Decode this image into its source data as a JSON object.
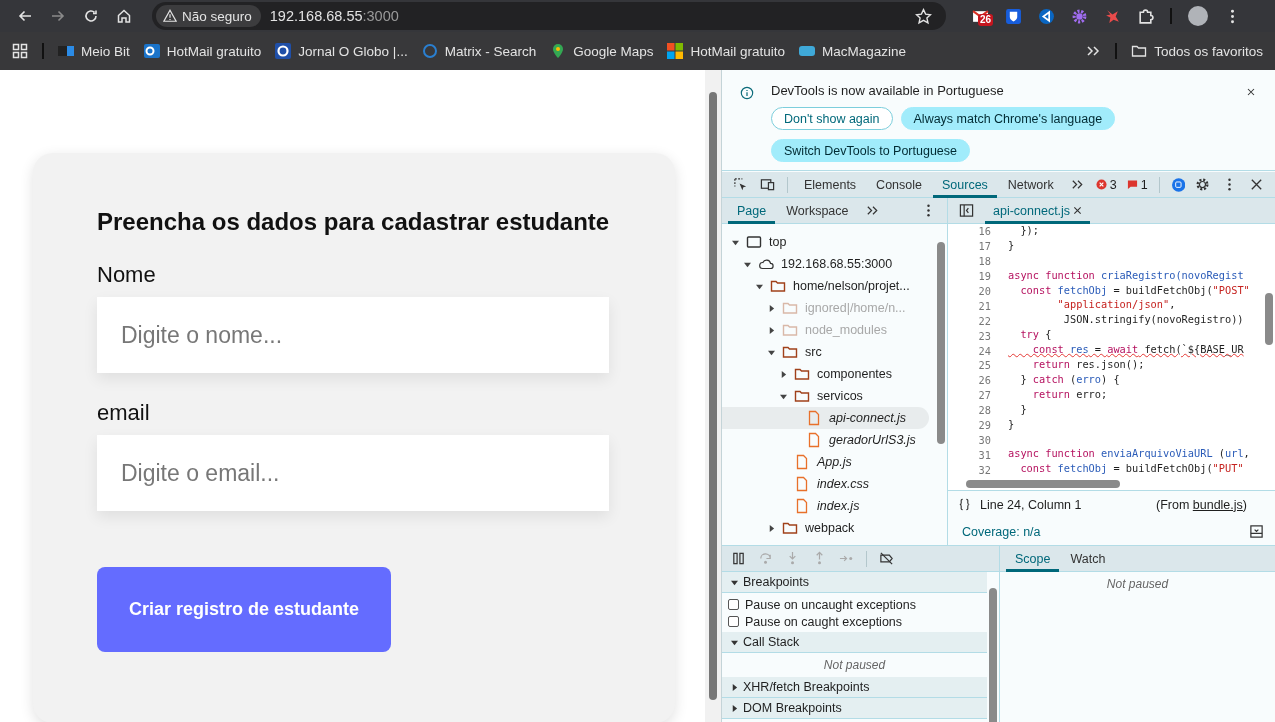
{
  "address_bar": {
    "security_label": "Não seguro",
    "host": "192.168.68.55",
    "port": ":3000"
  },
  "extension_badge": "26",
  "bookmarks": [
    {
      "label": "Meio Bit"
    },
    {
      "label": "HotMail gratuito"
    },
    {
      "label": "Jornal O Globo |..."
    },
    {
      "label": "Matrix - Search"
    },
    {
      "label": "Google Maps"
    },
    {
      "label": "HotMail gratuito"
    },
    {
      "label": "MacMagazine"
    }
  ],
  "all_bookmarks": "Todos os favoritos",
  "page": {
    "title": "Preencha os dados para cadastrar estudante",
    "fields": [
      {
        "label": "Nome",
        "placeholder": "Digite o nome..."
      },
      {
        "label": "email",
        "placeholder": "Digite o email..."
      }
    ],
    "submit": "Criar registro de estudante"
  },
  "devtools": {
    "infobar": {
      "message": "DevTools is now available in Portuguese",
      "buttons": [
        {
          "label": "Don't show again",
          "kind": "outline"
        },
        {
          "label": "Always match Chrome's language",
          "kind": "filled"
        },
        {
          "label": "Switch DevTools to Portuguese",
          "kind": "filled"
        }
      ]
    },
    "tabs": [
      {
        "label": "Elements",
        "selected": false
      },
      {
        "label": "Console",
        "selected": false
      },
      {
        "label": "Sources",
        "selected": true
      },
      {
        "label": "Network",
        "selected": false
      }
    ],
    "error_count": "3",
    "issue_count": "1",
    "navigator_tabs": [
      {
        "label": "Page",
        "selected": true
      },
      {
        "label": "Workspace",
        "selected": false
      }
    ],
    "tree": [
      {
        "label": "top",
        "kind": "frame",
        "expanded": true,
        "selected": false,
        "dimmed": false,
        "children": [
          {
            "label": "192.168.68.55:3000",
            "kind": "domain",
            "expanded": true,
            "selected": false,
            "dimmed": false,
            "children": [
              {
                "label": "home/nelson/projet...",
                "kind": "folder",
                "expanded": true,
                "selected": false,
                "dimmed": false,
                "children": [
                  {
                    "label": "ignored|/home/n...",
                    "kind": "folder",
                    "expanded": false,
                    "selected": false,
                    "dimmed": true
                  },
                  {
                    "label": "node_modules",
                    "kind": "folder",
                    "expanded": false,
                    "selected": false,
                    "dimmed": true
                  },
                  {
                    "label": "src",
                    "kind": "folder",
                    "expanded": true,
                    "selected": false,
                    "dimmed": false,
                    "children": [
                      {
                        "label": "componentes",
                        "kind": "folder",
                        "expanded": false,
                        "selected": false,
                        "dimmed": false
                      },
                      {
                        "label": "servicos",
                        "kind": "folder",
                        "expanded": true,
                        "selected": false,
                        "dimmed": false,
                        "children": [
                          {
                            "label": "api-connect.js",
                            "kind": "file",
                            "selected": true,
                            "dimmed": false
                          },
                          {
                            "label": "geradorUrlS3.js",
                            "kind": "file",
                            "selected": false,
                            "dimmed": false
                          }
                        ]
                      },
                      {
                        "label": "App.js",
                        "kind": "file",
                        "selected": false,
                        "dimmed": false
                      },
                      {
                        "label": "index.css",
                        "kind": "file",
                        "selected": false,
                        "dimmed": false
                      },
                      {
                        "label": "index.js",
                        "kind": "file",
                        "selected": false,
                        "dimmed": false
                      }
                    ]
                  },
                  {
                    "label": "webpack",
                    "kind": "folder",
                    "expanded": false,
                    "selected": false,
                    "dimmed": false
                  }
                ]
              }
            ]
          }
        ]
      }
    ],
    "editor_tab": "api-connect.js",
    "code": [
      {
        "num": "16",
        "error": false,
        "tokens": [
          {
            "kind": "plain",
            "text": "  });"
          }
        ]
      },
      {
        "num": "17",
        "error": false,
        "tokens": [
          {
            "kind": "plain",
            "text": "}"
          }
        ]
      },
      {
        "num": "18"
      },
      {
        "num": "19",
        "error": false,
        "tokens": [
          {
            "kind": "keyword",
            "text": "async"
          },
          {
            "kind": "keyword",
            "text": " function"
          },
          {
            "kind": "name",
            "text": " criaRegistro(novoRegist"
          }
        ]
      },
      {
        "num": "20",
        "error": false,
        "tokens": [
          {
            "kind": "keyword",
            "text": "  const"
          },
          {
            "kind": "name",
            "text": " fetchObj"
          },
          {
            "kind": "plain",
            "text": " = buildFetchObj("
          },
          {
            "kind": "string",
            "text": "\"POST\""
          }
        ]
      },
      {
        "num": "21",
        "error": false,
        "tokens": [
          {
            "kind": "string",
            "text": "        \"application/json\""
          },
          {
            "kind": "plain",
            "text": ","
          }
        ]
      },
      {
        "num": "22",
        "error": false,
        "tokens": [
          {
            "kind": "plain",
            "text": "         JSON.stringify(novoRegistro))"
          }
        ]
      },
      {
        "num": "23",
        "error": false,
        "tokens": [
          {
            "kind": "keyword",
            "text": "  try"
          },
          {
            "kind": "plain",
            "text": " {"
          }
        ]
      },
      {
        "num": "24",
        "error": true,
        "tokens": [
          {
            "kind": "keyword",
            "text": "    const"
          },
          {
            "kind": "name",
            "text": " res"
          },
          {
            "kind": "plain",
            "text": " = "
          },
          {
            "kind": "keyword",
            "text": "await"
          },
          {
            "kind": "plain",
            "text": " fetch(`${BASE_UR"
          }
        ]
      },
      {
        "num": "25",
        "error": false,
        "tokens": [
          {
            "kind": "keyword",
            "text": "    return"
          },
          {
            "kind": "plain",
            "text": " res.json();"
          }
        ]
      },
      {
        "num": "26",
        "error": false,
        "tokens": [
          {
            "kind": "plain",
            "text": "  } "
          },
          {
            "kind": "keyword",
            "text": "catch"
          },
          {
            "kind": "plain",
            "text": " ("
          },
          {
            "kind": "name",
            "text": "erro"
          },
          {
            "kind": "plain",
            "text": ") {"
          }
        ]
      },
      {
        "num": "27",
        "error": false,
        "tokens": [
          {
            "kind": "keyword",
            "text": "    return"
          },
          {
            "kind": "plain",
            "text": " erro;"
          }
        ]
      },
      {
        "num": "28",
        "error": false,
        "tokens": [
          {
            "kind": "plain",
            "text": "  }"
          }
        ]
      },
      {
        "num": "29",
        "error": false,
        "tokens": [
          {
            "kind": "plain",
            "text": "}"
          }
        ]
      },
      {
        "num": "30"
      },
      {
        "num": "31",
        "error": false,
        "tokens": [
          {
            "kind": "keyword",
            "text": "async"
          },
          {
            "kind": "keyword",
            "text": " function"
          },
          {
            "kind": "name",
            "text": " enviaArquivoViaURL"
          },
          {
            "kind": "plain",
            "text": " ("
          },
          {
            "kind": "name",
            "text": "url"
          },
          {
            "kind": "plain",
            "text": ","
          }
        ]
      },
      {
        "num": "32",
        "error": false,
        "tokens": [
          {
            "kind": "keyword",
            "text": "  const"
          },
          {
            "kind": "name",
            "text": " fetchObj"
          },
          {
            "kind": "plain",
            "text": " = buildFetchObj("
          },
          {
            "kind": "string",
            "text": "\"PUT\""
          }
        ]
      }
    ],
    "status": {
      "position": "Line 24, Column 1",
      "source_prefix": "(From ",
      "source_link": "bundle.js",
      "source_suffix": ")"
    },
    "coverage": "Coverage: n/a",
    "sections": [
      {
        "title": "Breakpoints",
        "expanded": true,
        "kind": "checkboxes",
        "items": [
          {
            "label": "Pause on uncaught exceptions",
            "checked": false
          },
          {
            "label": "Pause on caught exceptions",
            "checked": false
          }
        ]
      },
      {
        "title": "Call Stack",
        "expanded": true,
        "kind": "message",
        "message": "Not paused"
      },
      {
        "title": "XHR/fetch Breakpoints",
        "expanded": false
      },
      {
        "title": "DOM Breakpoints",
        "expanded": false
      }
    ],
    "side_tabs": [
      {
        "label": "Scope",
        "selected": true
      },
      {
        "label": "Watch",
        "selected": false
      }
    ],
    "side_message": "Not paused"
  }
}
